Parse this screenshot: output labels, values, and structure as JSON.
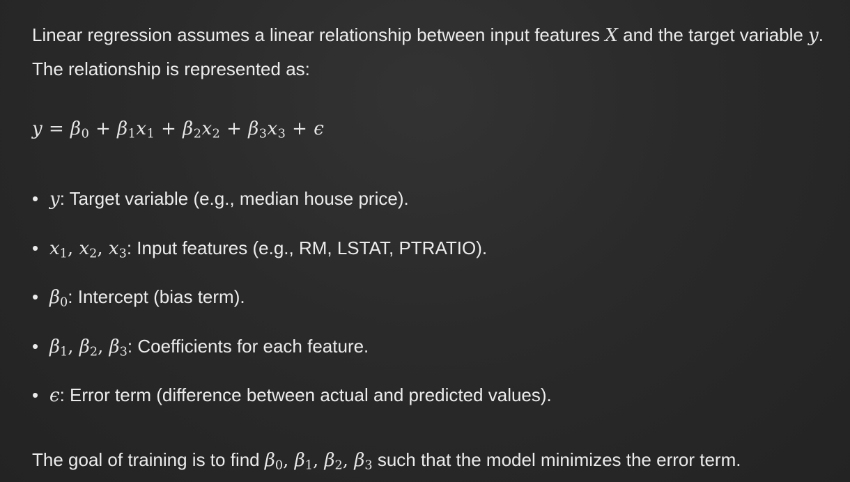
{
  "intro": {
    "text_a": "Linear regression assumes a linear relationship between input features ",
    "math_X": "X",
    "text_b": " and the target variable ",
    "math_y": "y",
    "text_c": ". The relationship is represented as:"
  },
  "equation": {
    "y": "y",
    "eq": " = ",
    "b": "β",
    "x": "x",
    "plus": " + ",
    "eps": "ϵ",
    "sub0": "0",
    "sub1": "1",
    "sub2": "2",
    "sub3": "3"
  },
  "bullets": [
    {
      "math": "y",
      "text": ": Target variable (e.g., median house price)."
    },
    {
      "text": ": Input features (e.g., RM, LSTAT, PTRATIO)."
    },
    {
      "text": ": Intercept (bias term)."
    },
    {
      "text": ": Coefficients for each feature."
    },
    {
      "math": "ϵ",
      "text": ": Error term (difference between actual and predicted values)."
    }
  ],
  "outro": {
    "text_a": "The goal of training is to find ",
    "text_b": " such that the model minimizes the error term."
  },
  "symbols": {
    "beta": "β",
    "x": "x",
    "comma": ", ",
    "bullet": "•"
  }
}
